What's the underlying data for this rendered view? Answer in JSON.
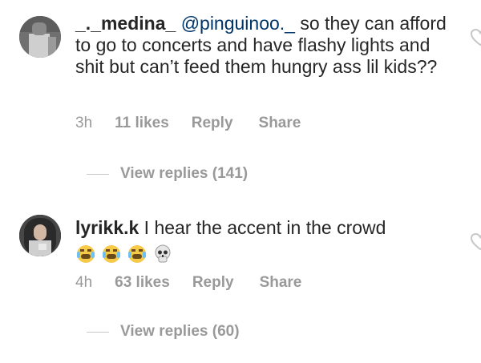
{
  "comments": [
    {
      "username": "_._medina_",
      "mention": "@pinguinoo._",
      "text": " so they can afford to go to concerts and have flashy lights and shit but can’t feed them hungry ass lil kids??",
      "emojis": [],
      "time": "3h",
      "likes": "11 likes",
      "reply_label": "Reply",
      "share_label": "Share",
      "view_replies": "View replies (141)"
    },
    {
      "username": "lyrikk.k",
      "mention": "",
      "text": " I hear the accent in the crowd",
      "emojis": [
        "face-with-tears-of-joy",
        "face-with-tears-of-joy",
        "face-with-tears-of-joy",
        "skull"
      ],
      "time": "4h",
      "likes": "63 likes",
      "reply_label": "Reply",
      "share_label": "Share",
      "view_replies": "View replies (60)"
    }
  ],
  "icons": {
    "like": "heart-outline-icon"
  },
  "colors": {
    "text": "#262626",
    "mention": "#003569",
    "meta": "#999999"
  }
}
